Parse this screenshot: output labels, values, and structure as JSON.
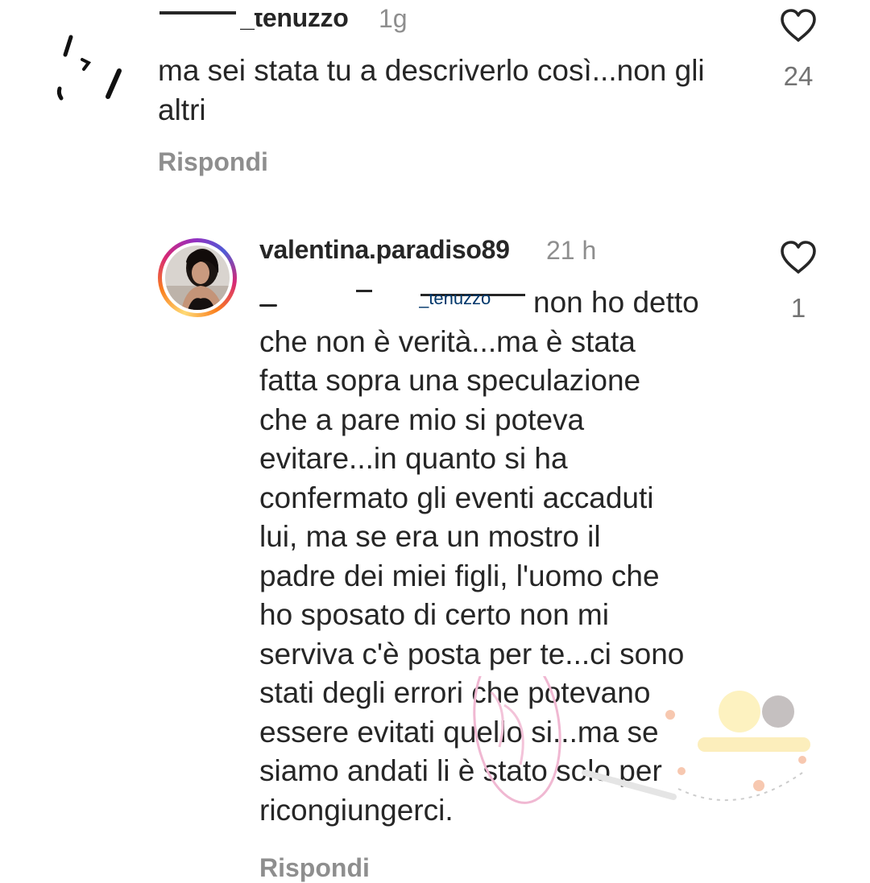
{
  "comments": [
    {
      "username": "_tenuzzo",
      "time": "1g",
      "text": "ma sei stata tu a descriverlo così...non gli altri",
      "reply_label": "Rispondi",
      "like_count": "24",
      "icons": {
        "avatar": "avatar-image",
        "like": "heart-outline-icon"
      }
    },
    {
      "username": "valentina.paradiso89",
      "time": "21 h",
      "mention": "_tenuzzo",
      "text": "non ho detto\nche non è verità...ma è stata\nfatta sopra una speculazione\nche a pare mio si poteva\nevitare...in quanto si ha\nconfermato gli eventi accaduti\nlui, ma se era un mostro il\npadre dei miei figli, l'uomo che\nho sposato di certo non mi\nserviva c'è posta per te...ci sono\nstati degli errori che potevano\nessere evitati quello si...ma se\nsiamo andati li è stato solo per\nricongiungerci.",
      "reply_label": "Rispondi",
      "like_count": "1",
      "icons": {
        "avatar": "avatar-image",
        "like": "heart-outline-icon"
      }
    }
  ],
  "colors": {
    "text": "#262626",
    "muted": "#8e8e8e",
    "story_ring": [
      "#feda75",
      "#fa7e1e",
      "#d62976",
      "#962fbf",
      "#4f5bd5"
    ]
  }
}
